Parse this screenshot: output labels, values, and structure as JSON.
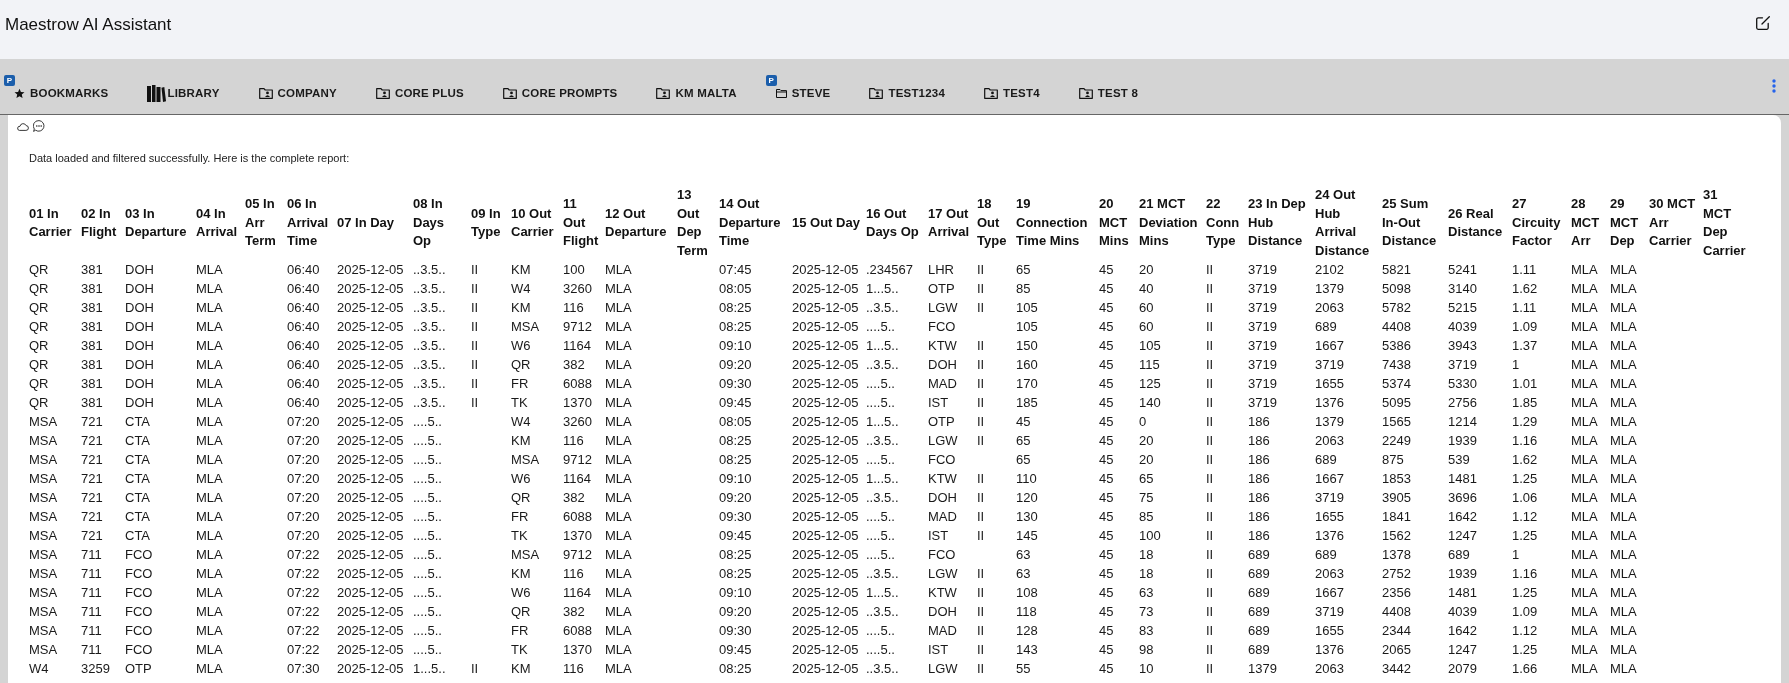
{
  "app": {
    "title": "Maestrow AI Assistant"
  },
  "tabs": [
    {
      "label": "BOOKMARKS",
      "kind": "bookmarks",
      "badge": "P",
      "selected": false
    },
    {
      "label": "LIBRARY",
      "kind": "library",
      "selected": false
    },
    {
      "label": "COMPANY",
      "kind": "team",
      "selected": false
    },
    {
      "label": "CORE PLUS",
      "kind": "team",
      "selected": false
    },
    {
      "label": "CORE PROMPTS",
      "kind": "team",
      "selected": false
    },
    {
      "label": "KM MALTA",
      "kind": "team",
      "selected": false
    },
    {
      "label": "STEVE",
      "kind": "personal",
      "badge": "P",
      "selected": false
    },
    {
      "label": "TEST1234",
      "kind": "team",
      "selected": false
    },
    {
      "label": "TEST4",
      "kind": "team",
      "selected": false
    },
    {
      "label": "TEST 8",
      "kind": "team",
      "selected": false
    }
  ],
  "message": {
    "text": "Data loaded and filtered successfully. Here is the complete report:"
  },
  "report": {
    "columns": [
      "01 In Carrier",
      "02 In Flight",
      "03 In Departure",
      "04 In Arrival",
      "05 In Arr Term",
      "06 In Arrival Time",
      "07 In Day",
      "08 In Days Op",
      "09 In Type",
      "10 Out Carrier",
      "11 Out Flight",
      "12 Out Departure",
      "13 Out Dep Term",
      "14 Out Departure Time",
      "15 Out Day",
      "16 Out Days Op",
      "17 Out Arrival",
      "18 Out Type",
      "19 Connection Time Mins",
      "20 MCT Mins",
      "21 MCT Deviation Mins",
      "22 Conn Type",
      "23 In Dep Hub Distance",
      "24 Out Hub Arrival Distance",
      "25 Sum In-Out Distance",
      "26 Real Distance",
      "27 Circuity Factor",
      "28 MCT Arr",
      "29 MCT Dep",
      "30 MCT Arr Carrier",
      "31 MCT Dep Carrier"
    ],
    "rows": [
      [
        "QR",
        "381",
        "DOH",
        "MLA",
        null,
        "06:40",
        "2025-12-05",
        "..3.5..",
        "II",
        "KM",
        "100",
        "MLA",
        null,
        "07:45",
        "2025-12-05",
        ".234567",
        "LHR",
        "II",
        "65",
        "45",
        "20",
        "II",
        "3719",
        "2102",
        "5821",
        "5241",
        "1.11",
        "MLA",
        "MLA"
      ],
      [
        "QR",
        "381",
        "DOH",
        "MLA",
        null,
        "06:40",
        "2025-12-05",
        "..3.5..",
        "II",
        "W4",
        "3260",
        "MLA",
        null,
        "08:05",
        "2025-12-05",
        "1...5..",
        "OTP",
        "II",
        "85",
        "45",
        "40",
        "II",
        "3719",
        "1379",
        "5098",
        "3140",
        "1.62",
        "MLA",
        "MLA"
      ],
      [
        "QR",
        "381",
        "DOH",
        "MLA",
        null,
        "06:40",
        "2025-12-05",
        "..3.5..",
        "II",
        "KM",
        "116",
        "MLA",
        null,
        "08:25",
        "2025-12-05",
        "..3.5..",
        "LGW",
        "II",
        "105",
        "45",
        "60",
        "II",
        "3719",
        "2063",
        "5782",
        "5215",
        "1.11",
        "MLA",
        "MLA"
      ],
      [
        "QR",
        "381",
        "DOH",
        "MLA",
        null,
        "06:40",
        "2025-12-05",
        "..3.5..",
        "II",
        "MSA",
        "9712",
        "MLA",
        null,
        "08:25",
        "2025-12-05",
        "....5..",
        "FCO",
        null,
        "105",
        "45",
        "60",
        "II",
        "3719",
        "689",
        "4408",
        "4039",
        "1.09",
        "MLA",
        "MLA"
      ],
      [
        "QR",
        "381",
        "DOH",
        "MLA",
        null,
        "06:40",
        "2025-12-05",
        "..3.5..",
        "II",
        "W6",
        "1164",
        "MLA",
        null,
        "09:10",
        "2025-12-05",
        "1...5..",
        "KTW",
        "II",
        "150",
        "45",
        "105",
        "II",
        "3719",
        "1667",
        "5386",
        "3943",
        "1.37",
        "MLA",
        "MLA"
      ],
      [
        "QR",
        "381",
        "DOH",
        "MLA",
        null,
        "06:40",
        "2025-12-05",
        "..3.5..",
        "II",
        "QR",
        "382",
        "MLA",
        null,
        "09:20",
        "2025-12-05",
        "..3.5..",
        "DOH",
        "II",
        "160",
        "45",
        "115",
        "II",
        "3719",
        "3719",
        "7438",
        "3719",
        "1",
        "MLA",
        "MLA"
      ],
      [
        "QR",
        "381",
        "DOH",
        "MLA",
        null,
        "06:40",
        "2025-12-05",
        "..3.5..",
        "II",
        "FR",
        "6088",
        "MLA",
        null,
        "09:30",
        "2025-12-05",
        "....5..",
        "MAD",
        "II",
        "170",
        "45",
        "125",
        "II",
        "3719",
        "1655",
        "5374",
        "5330",
        "1.01",
        "MLA",
        "MLA"
      ],
      [
        "QR",
        "381",
        "DOH",
        "MLA",
        null,
        "06:40",
        "2025-12-05",
        "..3.5..",
        "II",
        "TK",
        "1370",
        "MLA",
        null,
        "09:45",
        "2025-12-05",
        "....5..",
        "IST",
        "II",
        "185",
        "45",
        "140",
        "II",
        "3719",
        "1376",
        "5095",
        "2756",
        "1.85",
        "MLA",
        "MLA"
      ],
      [
        "MSA",
        "721",
        "CTA",
        "MLA",
        null,
        "07:20",
        "2025-12-05",
        "....5..",
        null,
        "W4",
        "3260",
        "MLA",
        null,
        "08:05",
        "2025-12-05",
        "1...5..",
        "OTP",
        "II",
        "45",
        "45",
        "0",
        "II",
        "186",
        "1379",
        "1565",
        "1214",
        "1.29",
        "MLA",
        "MLA"
      ],
      [
        "MSA",
        "721",
        "CTA",
        "MLA",
        null,
        "07:20",
        "2025-12-05",
        "....5..",
        null,
        "KM",
        "116",
        "MLA",
        null,
        "08:25",
        "2025-12-05",
        "..3.5..",
        "LGW",
        "II",
        "65",
        "45",
        "20",
        "II",
        "186",
        "2063",
        "2249",
        "1939",
        "1.16",
        "MLA",
        "MLA"
      ],
      [
        "MSA",
        "721",
        "CTA",
        "MLA",
        null,
        "07:20",
        "2025-12-05",
        "....5..",
        null,
        "MSA",
        "9712",
        "MLA",
        null,
        "08:25",
        "2025-12-05",
        "....5..",
        "FCO",
        null,
        "65",
        "45",
        "20",
        "II",
        "186",
        "689",
        "875",
        "539",
        "1.62",
        "MLA",
        "MLA"
      ],
      [
        "MSA",
        "721",
        "CTA",
        "MLA",
        null,
        "07:20",
        "2025-12-05",
        "....5..",
        null,
        "W6",
        "1164",
        "MLA",
        null,
        "09:10",
        "2025-12-05",
        "1...5..",
        "KTW",
        "II",
        "110",
        "45",
        "65",
        "II",
        "186",
        "1667",
        "1853",
        "1481",
        "1.25",
        "MLA",
        "MLA"
      ],
      [
        "MSA",
        "721",
        "CTA",
        "MLA",
        null,
        "07:20",
        "2025-12-05",
        "....5..",
        null,
        "QR",
        "382",
        "MLA",
        null,
        "09:20",
        "2025-12-05",
        "..3.5..",
        "DOH",
        "II",
        "120",
        "45",
        "75",
        "II",
        "186",
        "3719",
        "3905",
        "3696",
        "1.06",
        "MLA",
        "MLA"
      ],
      [
        "MSA",
        "721",
        "CTA",
        "MLA",
        null,
        "07:20",
        "2025-12-05",
        "....5..",
        null,
        "FR",
        "6088",
        "MLA",
        null,
        "09:30",
        "2025-12-05",
        "....5..",
        "MAD",
        "II",
        "130",
        "45",
        "85",
        "II",
        "186",
        "1655",
        "1841",
        "1642",
        "1.12",
        "MLA",
        "MLA"
      ],
      [
        "MSA",
        "721",
        "CTA",
        "MLA",
        null,
        "07:20",
        "2025-12-05",
        "....5..",
        null,
        "TK",
        "1370",
        "MLA",
        null,
        "09:45",
        "2025-12-05",
        "....5..",
        "IST",
        "II",
        "145",
        "45",
        "100",
        "II",
        "186",
        "1376",
        "1562",
        "1247",
        "1.25",
        "MLA",
        "MLA"
      ],
      [
        "MSA",
        "711",
        "FCO",
        "MLA",
        null,
        "07:22",
        "2025-12-05",
        "....5..",
        null,
        "MSA",
        "9712",
        "MLA",
        null,
        "08:25",
        "2025-12-05",
        "....5..",
        "FCO",
        null,
        "63",
        "45",
        "18",
        "II",
        "689",
        "689",
        "1378",
        "689",
        "1",
        "MLA",
        "MLA"
      ],
      [
        "MSA",
        "711",
        "FCO",
        "MLA",
        null,
        "07:22",
        "2025-12-05",
        "....5..",
        null,
        "KM",
        "116",
        "MLA",
        null,
        "08:25",
        "2025-12-05",
        "..3.5..",
        "LGW",
        "II",
        "63",
        "45",
        "18",
        "II",
        "689",
        "2063",
        "2752",
        "1939",
        "1.16",
        "MLA",
        "MLA"
      ],
      [
        "MSA",
        "711",
        "FCO",
        "MLA",
        null,
        "07:22",
        "2025-12-05",
        "....5..",
        null,
        "W6",
        "1164",
        "MLA",
        null,
        "09:10",
        "2025-12-05",
        "1...5..",
        "KTW",
        "II",
        "108",
        "45",
        "63",
        "II",
        "689",
        "1667",
        "2356",
        "1481",
        "1.25",
        "MLA",
        "MLA"
      ],
      [
        "MSA",
        "711",
        "FCO",
        "MLA",
        null,
        "07:22",
        "2025-12-05",
        "....5..",
        null,
        "QR",
        "382",
        "MLA",
        null,
        "09:20",
        "2025-12-05",
        "..3.5..",
        "DOH",
        "II",
        "118",
        "45",
        "73",
        "II",
        "689",
        "3719",
        "4408",
        "4039",
        "1.09",
        "MLA",
        "MLA"
      ],
      [
        "MSA",
        "711",
        "FCO",
        "MLA",
        null,
        "07:22",
        "2025-12-05",
        "....5..",
        null,
        "FR",
        "6088",
        "MLA",
        null,
        "09:30",
        "2025-12-05",
        "....5..",
        "MAD",
        "II",
        "128",
        "45",
        "83",
        "II",
        "689",
        "1655",
        "2344",
        "1642",
        "1.12",
        "MLA",
        "MLA"
      ],
      [
        "MSA",
        "711",
        "FCO",
        "MLA",
        null,
        "07:22",
        "2025-12-05",
        "....5..",
        null,
        "TK",
        "1370",
        "MLA",
        null,
        "09:45",
        "2025-12-05",
        "....5..",
        "IST",
        "II",
        "143",
        "45",
        "98",
        "II",
        "689",
        "1376",
        "2065",
        "1247",
        "1.25",
        "MLA",
        "MLA"
      ],
      [
        "W4",
        "3259",
        "OTP",
        "MLA",
        null,
        "07:30",
        "2025-12-05",
        "1...5..",
        "II",
        "KM",
        "116",
        "MLA",
        null,
        "08:25",
        "2025-12-05",
        "..3.5..",
        "LGW",
        "II",
        "55",
        "45",
        "10",
        "II",
        "1379",
        "2063",
        "3442",
        "2079",
        "1.66",
        "MLA",
        "MLA"
      ]
    ]
  }
}
